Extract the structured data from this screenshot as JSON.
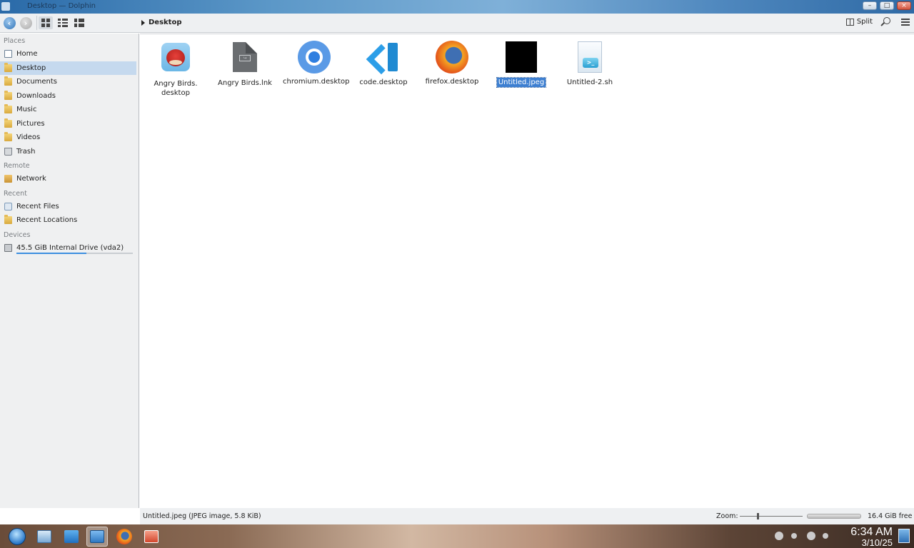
{
  "window": {
    "title": "Desktop — Dolphin"
  },
  "toolbar": {
    "back_icon": "back-arrow-icon",
    "forward_icon": "forward-arrow-icon",
    "breadcrumb": "Desktop",
    "split_label": "Split",
    "search_icon": "search-icon",
    "menu_icon": "hamburger-menu-icon"
  },
  "sidebar": {
    "places_header": "Places",
    "places": [
      {
        "label": "Home",
        "icon": "home-icon"
      },
      {
        "label": "Desktop",
        "icon": "desktop-folder-icon",
        "selected": true
      },
      {
        "label": "Documents",
        "icon": "documents-folder-icon"
      },
      {
        "label": "Downloads",
        "icon": "downloads-folder-icon"
      },
      {
        "label": "Music",
        "icon": "music-folder-icon"
      },
      {
        "label": "Pictures",
        "icon": "pictures-folder-icon"
      },
      {
        "label": "Videos",
        "icon": "videos-folder-icon"
      },
      {
        "label": "Trash",
        "icon": "trash-icon"
      }
    ],
    "remote_header": "Remote",
    "remote": [
      {
        "label": "Network",
        "icon": "network-folder-icon"
      }
    ],
    "recent_header": "Recent",
    "recent": [
      {
        "label": "Recent Files",
        "icon": "recent-files-icon"
      },
      {
        "label": "Recent Locations",
        "icon": "recent-locations-icon"
      }
    ],
    "devices_header": "Devices",
    "devices": [
      {
        "label": "45.5 GiB Internal Drive (vda2)",
        "icon": "drive-icon",
        "usage_fraction": 0.6
      }
    ]
  },
  "files": [
    {
      "name_line1": "Angry Birds.",
      "name_line2": "desktop",
      "icon": "angry-birds-icon"
    },
    {
      "name_line1": "Angry Birds.lnk",
      "name_line2": "",
      "icon": "link-file-icon"
    },
    {
      "name_line1": "chromium.desktop",
      "name_line2": "",
      "icon": "chromium-icon"
    },
    {
      "name_line1": "code.desktop",
      "name_line2": "",
      "icon": "vscode-icon"
    },
    {
      "name_line1": "firefox.desktop",
      "name_line2": "",
      "icon": "firefox-icon"
    },
    {
      "name_line1": "Untitled.jpeg",
      "name_line2": "",
      "icon": "black-image-thumbnail",
      "selected": true
    },
    {
      "name_line1": "Untitled-2.sh",
      "name_line2": "",
      "icon": "shell-script-icon"
    }
  ],
  "statusbar": {
    "selection_info": "Untitled.jpeg (JPEG image, 5.8 KiB)",
    "zoom_label": "Zoom:",
    "zoom_level_fraction": 0.28,
    "free_space": "16.4 GiB free"
  },
  "taskbar": {
    "apps": [
      {
        "icon": "start-menu-icon"
      },
      {
        "icon": "system-settings-icon"
      },
      {
        "icon": "software-center-icon"
      },
      {
        "icon": "dolphin-file-manager-icon",
        "active": true
      },
      {
        "icon": "firefox-icon"
      },
      {
        "icon": "presentation-app-icon"
      }
    ],
    "tray": [
      "volume-icon",
      "network-icon",
      "battery-icon"
    ],
    "clock_time": "6:34 AM",
    "clock_date": "3/10/25"
  },
  "colors": {
    "selection": "#3d7fd1",
    "sidebar_selected": "#c5d9ee",
    "sidebar_bg": "#eff0f1",
    "titlebar": "#5c98c8"
  }
}
